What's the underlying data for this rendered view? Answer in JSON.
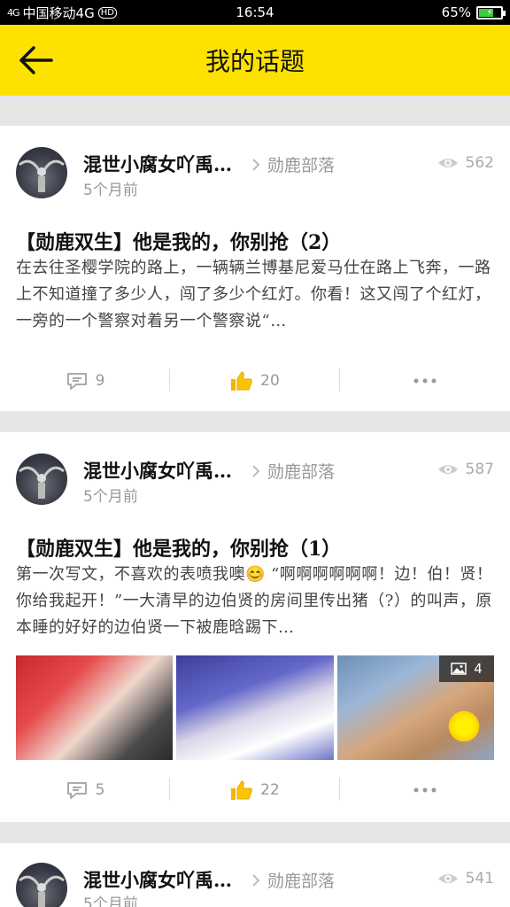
{
  "status_bar": {
    "signal": "4G",
    "carrier": "中国移动4G",
    "hd": "HD",
    "time": "16:54",
    "battery": "65%",
    "battery_level": 0.65
  },
  "header": {
    "title": "我的话题"
  },
  "posts": [
    {
      "author": "混世小腐女吖禹…",
      "time": "5个月前",
      "tribe": "勋鹿部落",
      "views": "562",
      "title": "【勋鹿双生】他是我的，你别抢（2）",
      "body": "在去往圣樱学院的路上，一辆辆兰博基尼爱马仕在路上飞奔，一路上不知道撞了多少人，闯了多少个红灯。你看！这又闯了个红灯，一旁的一个警察对着另一个警察说“…",
      "comments": "9",
      "likes": "20"
    },
    {
      "author": "混世小腐女吖禹…",
      "time": "5个月前",
      "tribe": "勋鹿部落",
      "views": "587",
      "title": "【勋鹿双生】他是我的，你别抢（1）",
      "body": "第一次写文，不喜欢的表喷我噢😊 “啊啊啊啊啊啊！边！伯！贤！你给我起开！”一大清早的边伯贤的房间里传出猪（?）的叫声，原本睡的好好的边伯贤一下被鹿晗踢下…",
      "image_count": "4",
      "comments": "5",
      "likes": "22"
    },
    {
      "author": "混世小腐女吖禹…",
      "time": "5个月前",
      "tribe": "勋鹿部落",
      "views": "541"
    }
  ]
}
